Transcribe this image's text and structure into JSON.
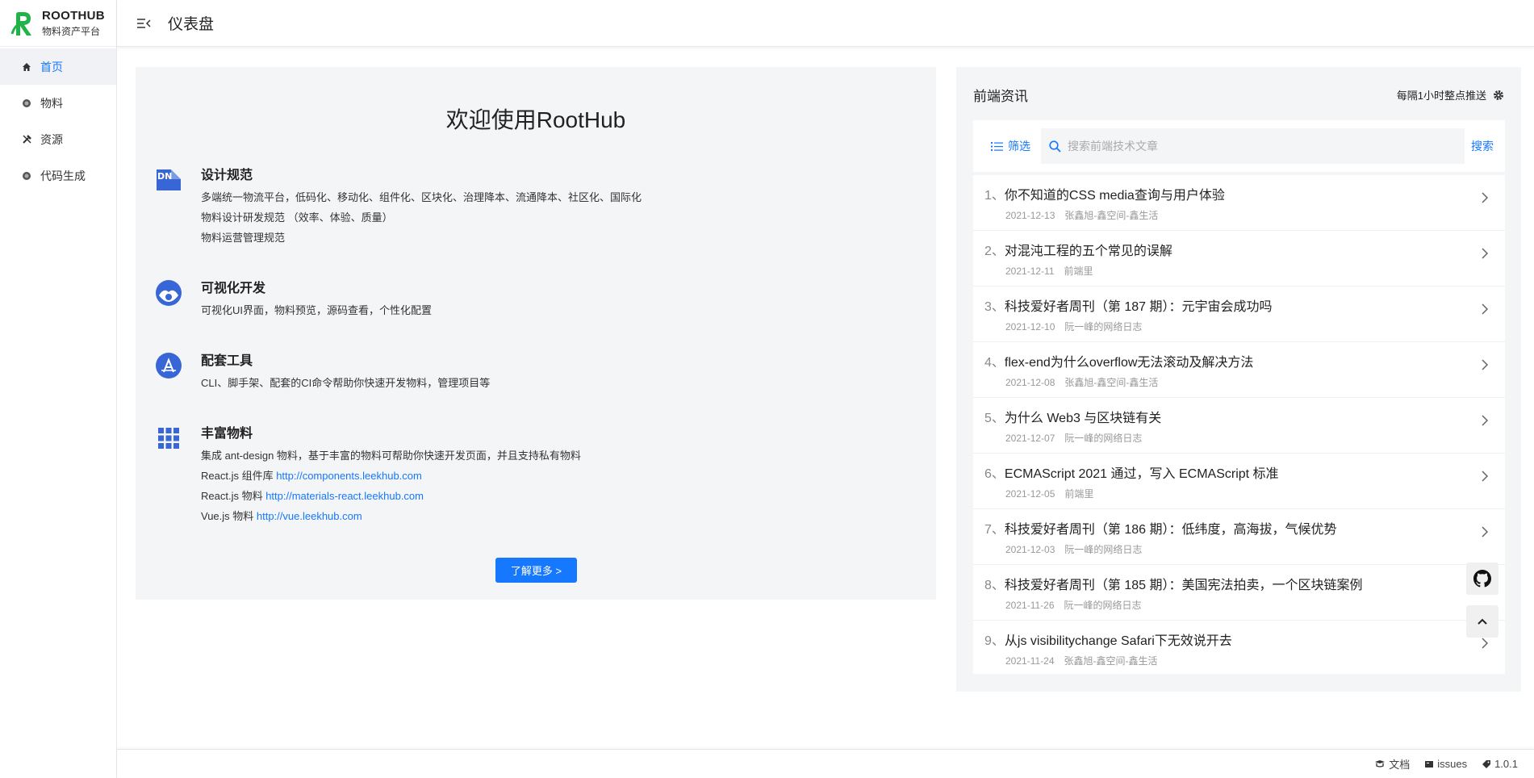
{
  "app": {
    "name": "ROOTHUB",
    "subtitle": "物料资产平台"
  },
  "sidebar": {
    "items": [
      {
        "label": "首页",
        "icon": "home-icon",
        "active": true
      },
      {
        "label": "物料",
        "icon": "material-icon",
        "active": false
      },
      {
        "label": "资源",
        "icon": "tools-icon",
        "active": false
      },
      {
        "label": "代码生成",
        "icon": "codegen-icon",
        "active": false
      }
    ]
  },
  "header": {
    "title": "仪表盘"
  },
  "welcome": {
    "title": "欢迎使用RootHub",
    "features": [
      {
        "title": "设计规范",
        "lines": [
          "多端统一物流平台，低码化、移动化、组件化、区块化、治理降本、流通降本、社区化、国际化",
          "物料设计研发规范 （效率、体验、质量）",
          "物料运营管理规范"
        ]
      },
      {
        "title": "可视化开发",
        "lines": [
          "可视化UI界面，物料预览，源码查看，个性化配置"
        ]
      },
      {
        "title": "配套工具",
        "lines": [
          "CLI、脚手架、配套的CI命令帮助你快速开发物料，管理项目等"
        ]
      },
      {
        "title": "丰富物料",
        "lines": [
          "集成 ant-design 物料，基于丰富的物料可帮助你快速开发页面，并且支持私有物料"
        ],
        "links": [
          {
            "prefix": "React.js 组件库 ",
            "url": "http://components.leekhub.com"
          },
          {
            "prefix": "React.js 物料 ",
            "url": "http://materials-react.leekhub.com"
          },
          {
            "prefix": "Vue.js 物料 ",
            "url": "http://vue.leekhub.com"
          }
        ]
      }
    ],
    "more_button": "了解更多 >"
  },
  "news": {
    "title": "前端资讯",
    "push_label": "每隔1小时整点推送",
    "filter_label": "筛选",
    "search_placeholder": "搜索前端技术文章",
    "search_label": "搜索",
    "items": [
      {
        "index": "1、",
        "title": "你不知道的CSS media查询与用户体验",
        "date": "2021-12-13",
        "source": "张鑫旭-鑫空间-鑫生活"
      },
      {
        "index": "2、",
        "title": "对混沌工程的五个常见的误解",
        "date": "2021-12-11",
        "source": "前端里"
      },
      {
        "index": "3、",
        "title": "科技爱好者周刊（第 187 期）：元宇宙会成功吗",
        "date": "2021-12-10",
        "source": "阮一峰的网络日志"
      },
      {
        "index": "4、",
        "title": "flex-end为什么overflow无法滚动及解决方法",
        "date": "2021-12-08",
        "source": "张鑫旭-鑫空间-鑫生活"
      },
      {
        "index": "5、",
        "title": "为什么 Web3 与区块链有关",
        "date": "2021-12-07",
        "source": "阮一峰的网络日志"
      },
      {
        "index": "6、",
        "title": "ECMAScript 2021 通过，写入 ECMAScript 标准",
        "date": "2021-12-05",
        "source": "前端里"
      },
      {
        "index": "7、",
        "title": "科技爱好者周刊（第 186 期）：低纬度，高海拔，气候优势",
        "date": "2021-12-03",
        "source": "阮一峰的网络日志"
      },
      {
        "index": "8、",
        "title": "科技爱好者周刊（第 185 期）：美国宪法拍卖，一个区块链案例",
        "date": "2021-11-26",
        "source": "阮一峰的网络日志"
      },
      {
        "index": "9、",
        "title": "从js visibilitychange Safari下无效说开去",
        "date": "2021-11-24",
        "source": "张鑫旭-鑫空间-鑫生活"
      }
    ]
  },
  "footer": {
    "docs": "文档",
    "issues": "issues",
    "version": "1.0.1"
  },
  "colors": {
    "accent": "#1677ff",
    "logo": "#21b24a",
    "feature_icon": "#3866d6"
  }
}
